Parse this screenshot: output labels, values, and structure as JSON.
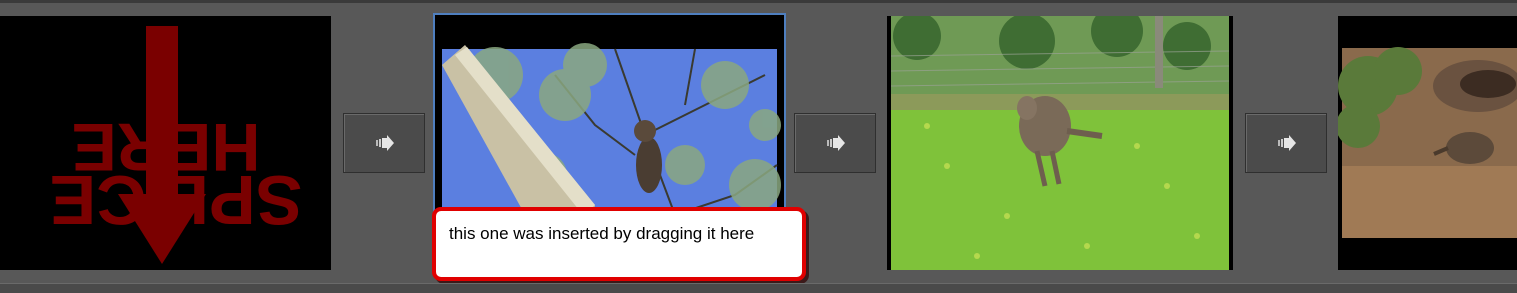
{
  "timeline": {
    "clips": [
      {
        "name": "splice-here-marker",
        "title_lines": [
          "HERE",
          "SPLICE"
        ],
        "mirrored": true,
        "color": "#7a0000"
      },
      {
        "name": "koala-clip",
        "subject": "koala in eucalyptus tree",
        "selected": true
      },
      {
        "name": "kangaroo-clip",
        "subject": "kangaroo hopping on grass"
      },
      {
        "name": "echidna-clip",
        "subject": "echidna near log"
      }
    ],
    "transitions": [
      {
        "icon": "arrow-right-icon"
      },
      {
        "icon": "arrow-right-icon"
      },
      {
        "icon": "arrow-right-icon"
      }
    ]
  },
  "callout": {
    "text": "this one was inserted by dragging it here",
    "border_color": "#e00000"
  },
  "colors": {
    "background": "#585858",
    "selection": "#4f7fbf"
  }
}
